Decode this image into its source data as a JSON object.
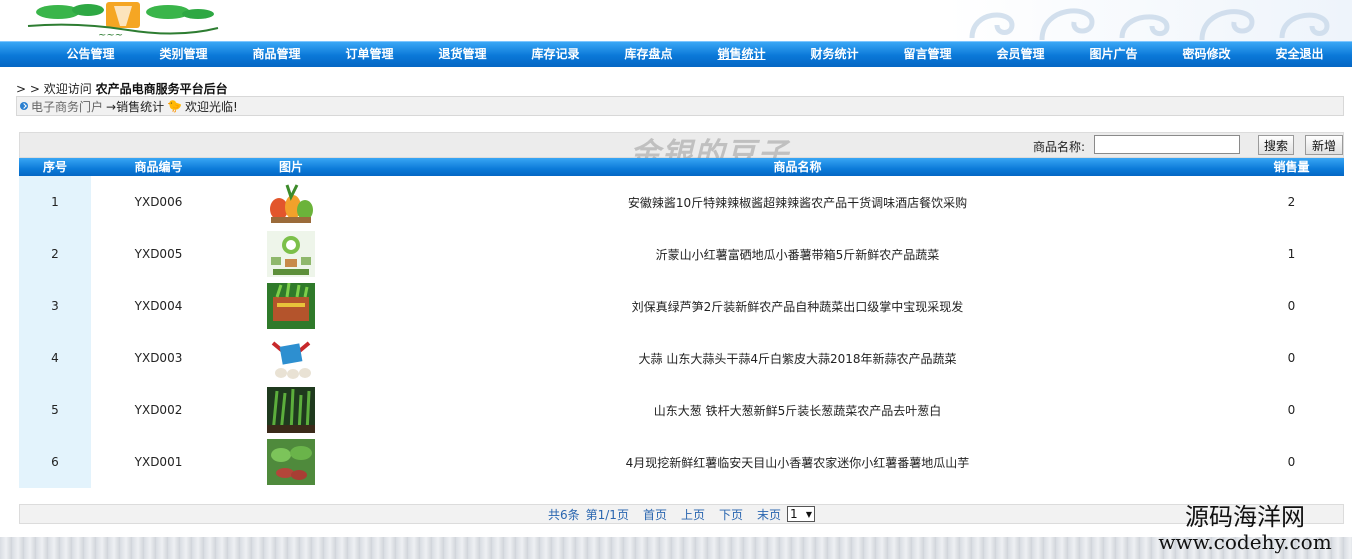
{
  "nav": {
    "items": [
      {
        "label": "公告管理"
      },
      {
        "label": "类别管理"
      },
      {
        "label": "商品管理"
      },
      {
        "label": "订单管理"
      },
      {
        "label": "退货管理"
      },
      {
        "label": "库存记录"
      },
      {
        "label": "库存盘点"
      },
      {
        "label": "销售统计"
      },
      {
        "label": "财务统计"
      },
      {
        "label": "留言管理"
      },
      {
        "label": "会员管理"
      },
      {
        "label": "图片广告"
      },
      {
        "label": "密码修改"
      },
      {
        "label": "安全退出"
      }
    ],
    "active_index": 7
  },
  "welcome": {
    "prefix": "> > 欢迎访问 ",
    "site_name": "农产品电商服务平台后台"
  },
  "breadcrumb": {
    "home": "电子商务门户",
    "current": "→销售统计",
    "greeting": "欢迎光临!"
  },
  "search": {
    "watermark": "金银的豆子",
    "label": "商品名称:",
    "value": "",
    "placeholder": "",
    "search_button": "搜索",
    "add_button": "新增"
  },
  "table": {
    "headers": [
      "序号",
      "商品编号",
      "图片",
      "商品名称",
      "销售量"
    ],
    "rows": [
      {
        "index": "1",
        "code": "YXD006",
        "name": "安徽辣酱10斤特辣辣椒酱超辣辣酱农产品干货调味酒店餐饮采购",
        "sales": "2"
      },
      {
        "index": "2",
        "code": "YXD005",
        "name": "沂蒙山小红薯富硒地瓜小番薯带箱5斤新鲜农产品蔬菜",
        "sales": "1"
      },
      {
        "index": "3",
        "code": "YXD004",
        "name": "刘保真绿芦笋2斤装新鲜农产品自种蔬菜出口级掌中宝现采现发",
        "sales": "0"
      },
      {
        "index": "4",
        "code": "YXD003",
        "name": "大蒜 山东大蒜头干蒜4斤白紫皮大蒜2018年新蒜农产品蔬菜",
        "sales": "0"
      },
      {
        "index": "5",
        "code": "YXD002",
        "name": "山东大葱 铁杆大葱新鲜5斤装长葱蔬菜农产品去叶葱白",
        "sales": "0"
      },
      {
        "index": "6",
        "code": "YXD001",
        "name": "4月现挖新鲜红薯临安天目山小香薯农家迷你小红薯番薯地瓜山芋",
        "sales": "0"
      }
    ]
  },
  "pager": {
    "total": "共6条",
    "pages": "第1/1页",
    "first": "首页",
    "prev": "上页",
    "next": "下页",
    "last": "末页",
    "select_value": "1"
  },
  "site_mark": {
    "cn": "源码海洋网",
    "en": "www.codehy.com"
  },
  "colors": {
    "nav_blue": "#0a78d8",
    "header_blue": "#39a6f4",
    "index_cell_bg": "#e3f3fc",
    "link_blue": "#2a66b0"
  }
}
